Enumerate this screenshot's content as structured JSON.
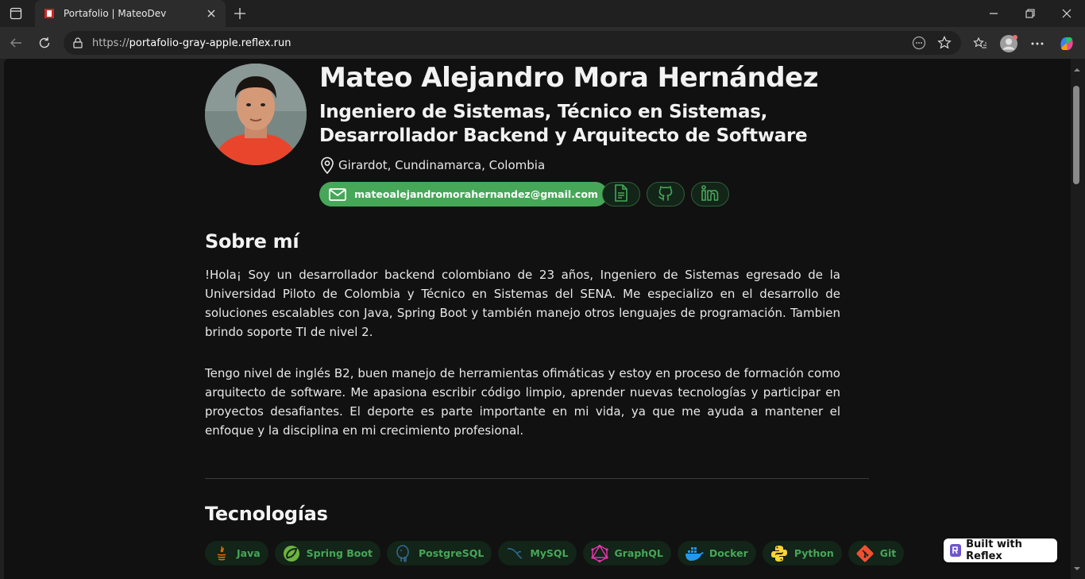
{
  "browser": {
    "tab_title": "Portafolio | MateoDev",
    "url_prefix": "https://",
    "url_host": "portafolio-gray-apple.reflex.run"
  },
  "profile": {
    "name": "Mateo Alejandro Mora Hernández",
    "subtitle": "Ingeniero de Sistemas, Técnico en Sistemas, Desarrollador Backend y Arquitecto de Software",
    "location": "Girardot, Cundinamarca, Colombia",
    "email": "mateoalejandromorahernandez@gmail.com",
    "links": [
      "document-icon",
      "github-icon",
      "linkedin-icon"
    ]
  },
  "about": {
    "title": "Sobre mí",
    "p1": "!Hola¡ Soy un desarrollador backend colombiano de 23 años, Ingeniero de Sistemas egresado de la Universidad Piloto de Colombia y Técnico en Sistemas del SENA. Me especializo en el desarrollo de soluciones escalables con Java, Spring Boot y también manejo otros lenguajes de programación. Tambien brindo soporte TI de nivel 2.",
    "p2": "Tengo nivel de inglés B2, buen manejo de herramientas ofimáticas y estoy en proceso de formación como arquitecto de software. Me apasiona escribir código limpio, aprender nuevas tecnologías y participar en proyectos desafiantes. El deporte es parte importante en mi vida, ya que me ayuda a mantener el enfoque y la disciplina en mi crecimiento profesional."
  },
  "tech": {
    "title": "Tecnologías",
    "items": [
      {
        "label": "Java",
        "icon": "java-icon"
      },
      {
        "label": "Spring Boot",
        "icon": "spring-icon"
      },
      {
        "label": "PostgreSQL",
        "icon": "postgresql-icon"
      },
      {
        "label": "MySQL",
        "icon": "mysql-icon"
      },
      {
        "label": "GraphQL",
        "icon": "graphql-icon"
      },
      {
        "label": "Docker",
        "icon": "docker-icon"
      },
      {
        "label": "Python",
        "icon": "python-icon"
      },
      {
        "label": "Git",
        "icon": "git-icon"
      }
    ]
  },
  "badge": {
    "label": "Built with Reflex"
  },
  "colors": {
    "accent": "#46a758",
    "pill_bg": "#132418",
    "page_bg": "#111111"
  }
}
